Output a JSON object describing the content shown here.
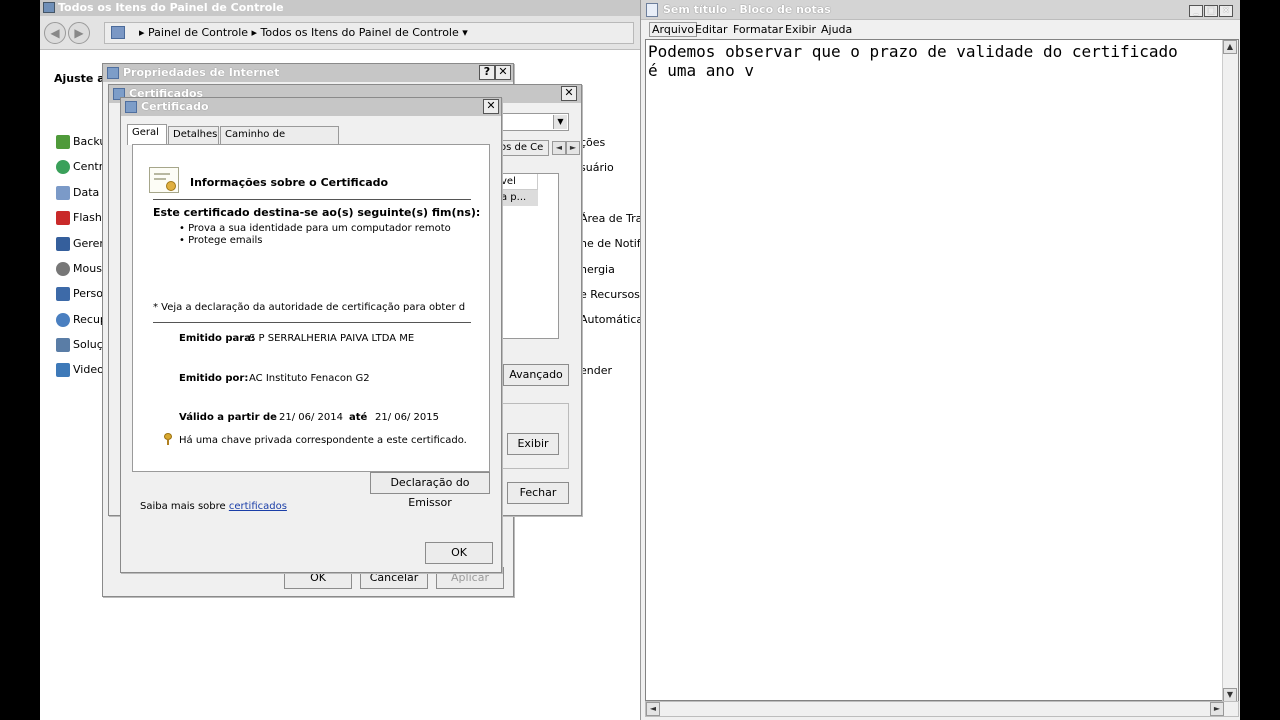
{
  "control_panel": {
    "title": "Todos os Itens do Painel de Controle",
    "back_glyph": "◀",
    "forward_glyph": "▶",
    "address": "▸ Painel de Controle ▸ Todos os Itens do Painel de Controle ▾",
    "heading": "Ajuste as",
    "items": [
      "Backup",
      "Centra",
      "Data e",
      "Flash P",
      "Geren",
      "Mouse",
      "Person",
      "Recup",
      "Soluçã",
      "Video"
    ],
    "right_items": [
      "ções",
      "suário",
      "",
      "Área de Traba",
      "ne de Notifica",
      "nergia",
      "e Recursos",
      "Automática",
      "",
      "ender"
    ],
    "colors": {
      "titlebar": "#c8c8c8",
      "accent": "#7a97c4"
    }
  },
  "internet_props": {
    "title": "Propriedades de Internet",
    "help_glyph": "?",
    "close_glyph": "✕",
    "ok": "OK",
    "cancel": "Cancelar",
    "apply": "Aplicar"
  },
  "certificates": {
    "title": "Certificados",
    "close_glyph": "✕",
    "dropdown_glyph": "▼",
    "tab_fragment": "os de Ce",
    "scroll_left_glyph": "◄",
    "scroll_right_glyph": "►",
    "col_header": "vel",
    "cell": "a p...",
    "advanced": "Avançado",
    "view": "Exibir",
    "close": "Fechar"
  },
  "certificate": {
    "title": "Certificado",
    "close_glyph": "✕",
    "tabs": [
      "Geral",
      "Detalhes",
      "Caminho de Certificação"
    ],
    "info_heading": "Informações sobre o Certificado",
    "purpose_heading": "Este certificado destina-se ao(s) seguinte(s) fim(ns):",
    "purposes": [
      "• Prova a sua identidade para um computador remoto",
      "• Protege emails"
    ],
    "note": "* Veja a declaração da autoridade de certificação para obter d",
    "issued_to_label": "Emitido para:",
    "issued_to": "S P SERRALHERIA PAIVA LTDA ME",
    "issued_by_label": "Emitido por:",
    "issued_by": "AC Instituto Fenacon G2",
    "valid_from_label": "Válido a partir de",
    "valid_from": "21/ 06/ 2014",
    "until_label": "até",
    "valid_to": "21/ 06/ 2015",
    "private_key": "Há uma chave privada correspondente a este certificado.",
    "issuer_statement": "Declaração do Emissor",
    "learn_more": "Saiba mais sobre",
    "learn_more_link": "certificados",
    "ok": "OK"
  },
  "notepad": {
    "title": "Sem título - Bloco de notas",
    "minimize_glyph": "_",
    "maximize_glyph": "□",
    "close_glyph": "✕",
    "menu": [
      "Arquivo",
      "Editar",
      "Formatar",
      "Exibir",
      "Ajuda"
    ],
    "text": "Podemos observar que o prazo de validade do certificado\né uma ano v",
    "up_glyph": "▲",
    "down_glyph": "▼",
    "left_glyph": "◄",
    "right_glyph": "►"
  }
}
